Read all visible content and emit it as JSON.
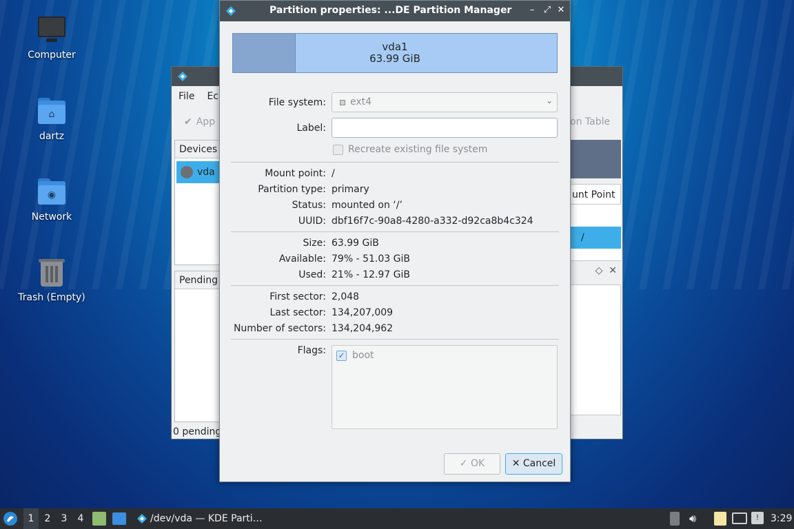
{
  "desktop": {
    "icons": [
      {
        "label": "Computer",
        "icon": "computer-icon"
      },
      {
        "label": "dartz",
        "icon": "home-folder-icon"
      },
      {
        "label": "Network",
        "icon": "network-folder-icon"
      },
      {
        "label": "Trash (Empty)",
        "icon": "trash-icon"
      }
    ]
  },
  "main_window": {
    "menu": [
      "File",
      "Ec"
    ],
    "toolbar_apply": "App",
    "toolbar_right": "on Table",
    "devices_header": "Devices",
    "device_item": "vda",
    "column_header_right": "unt Point",
    "row_mount": "/",
    "pending_header": "Pending C",
    "status": "0 pending"
  },
  "dialog": {
    "title": "Partition properties: ...DE Partition Manager",
    "partition_name": "vda1",
    "partition_size": "63.99 GiB",
    "file_system_label": "File system:",
    "file_system_value": "ext4",
    "label_label": "Label:",
    "label_value": "",
    "recreate_label": "Recreate existing file system",
    "mount_point_label": "Mount point:",
    "mount_point_value": "/",
    "partition_type_label": "Partition type:",
    "partition_type_value": "primary",
    "status_label": "Status:",
    "status_value": "mounted on ‘/’",
    "uuid_label": "UUID:",
    "uuid_value": "dbf16f7c-90a8-4280-a332-d92ca8b4c324",
    "size_label": "Size:",
    "size_value": "63.99 GiB",
    "available_label": "Available:",
    "available_value": "79% - 51.03 GiB",
    "used_label": "Used:",
    "used_value": "21% - 12.97 GiB",
    "first_sector_label": "First sector:",
    "first_sector_value": "2,048",
    "last_sector_label": "Last sector:",
    "last_sector_value": "134,207,009",
    "num_sectors_label": "Number of sectors:",
    "num_sectors_value": "134,204,962",
    "flags_label": "Flags:",
    "flag_boot": "boot",
    "ok_label": "OK",
    "cancel_label": "Cancel"
  },
  "taskbar": {
    "workspaces": [
      "1",
      "2",
      "3",
      "4"
    ],
    "task_title": "/dev/vda — KDE Parti…",
    "clock": "3:29"
  }
}
